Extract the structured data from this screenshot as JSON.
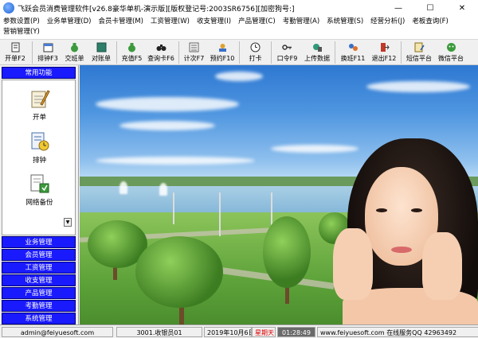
{
  "window": {
    "title": "飞跃会员消费管理软件[v26.8豪华单机-演示版][版权登记号:2003SR6756][加密狗号:]",
    "minimize": "—",
    "maximize": "☐",
    "close": "✕"
  },
  "menu": [
    "参数设置(P)",
    "业务单管理(D)",
    "会员卡管理(M)",
    "工资管理(W)",
    "收支管理(I)",
    "产品管理(C)",
    "考勤管理(A)",
    "系统管理(S)",
    "经营分析(J)",
    "老板查询(F)",
    "营销管理(Y)"
  ],
  "toolbar": [
    {
      "label": "开单F2",
      "icon": "bill-icon"
    },
    {
      "label": "排钟F3",
      "icon": "schedule-icon"
    },
    {
      "label": "交班单",
      "icon": "money-bag-icon"
    },
    {
      "label": "对账单",
      "icon": "ledger-icon"
    },
    {
      "label": "充值F5",
      "icon": "recharge-icon"
    },
    {
      "label": "查询卡F6",
      "icon": "binoculars-icon"
    },
    {
      "label": "计次F7",
      "icon": "counter-icon"
    },
    {
      "label": "预约F10",
      "icon": "appointment-icon"
    },
    {
      "label": "打卡",
      "icon": "clock-icon"
    },
    {
      "label": "口令F9",
      "icon": "key-icon"
    },
    {
      "label": "上传数据",
      "icon": "upload-icon"
    },
    {
      "label": "换班F11",
      "icon": "shift-icon"
    },
    {
      "label": "退出F12",
      "icon": "exit-icon"
    },
    {
      "label": "短信平台",
      "icon": "sms-icon"
    },
    {
      "label": "微信平台",
      "icon": "wechat-icon"
    }
  ],
  "side": {
    "header": "常用功能",
    "features": [
      {
        "label": "开单",
        "icon": "pencil-paper-icon"
      },
      {
        "label": "排钟",
        "icon": "clock-document-icon"
      },
      {
        "label": "网络备份",
        "icon": "network-backup-icon"
      }
    ],
    "scroll": "▼",
    "categories": [
      "业务管理",
      "会员管理",
      "工资管理",
      "收支管理",
      "产品管理",
      "考勤管理",
      "系统管理"
    ]
  },
  "status": {
    "email": "admin@feiyuesoft.com",
    "user": "3001.收银员01",
    "date": "2019年10月6日",
    "weekday": "星期天",
    "time": "01:28:49",
    "website": "www.feiyuesoft.com",
    "support": "在线服务QQ 42963492"
  },
  "colors": {
    "category_bg": "#1a1aff",
    "weekday_text": "#e00000",
    "time_bg": "#6a6a6a"
  }
}
